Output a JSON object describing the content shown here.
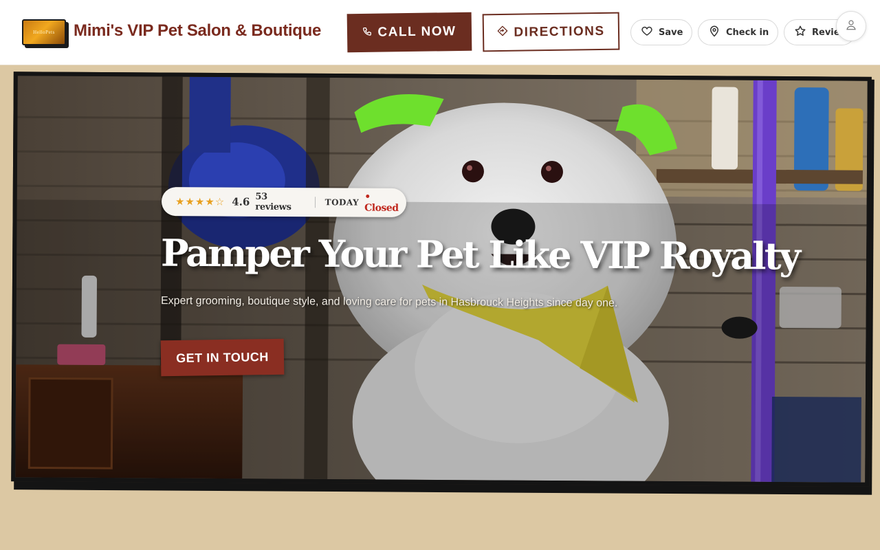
{
  "header": {
    "logo_text": "HelloPets",
    "title": "Mimi's VIP Pet Salon & Boutique",
    "call_label": "CALL NOW",
    "directions_label": "DIRECTIONS",
    "actions": {
      "save": "Save",
      "check_in": "Check in",
      "review": "Review"
    }
  },
  "hero": {
    "rating": {
      "stars": "★★★★☆",
      "value": "4.6",
      "reviews": "53 reviews",
      "day": "TODAY",
      "status": "• Closed"
    },
    "title": "Pamper Your Pet Like VIP Royalty",
    "subtitle": "Expert grooming, boutique style, and loving care for pets in Hasbrouck Heights since day one.",
    "cta_label": "GET IN TOUCH"
  },
  "colors": {
    "brand": "#7a2a1e",
    "button": "#6b2d20",
    "cta": "#8a2e22",
    "page_bg": "#dcc8a3",
    "star": "#e8a020",
    "closed": "#c0281e"
  },
  "icons": {
    "call": "phone-icon",
    "directions": "directions-icon",
    "save": "heart-icon",
    "check_in": "map-pin-icon",
    "review": "star-icon",
    "account": "user-icon"
  }
}
